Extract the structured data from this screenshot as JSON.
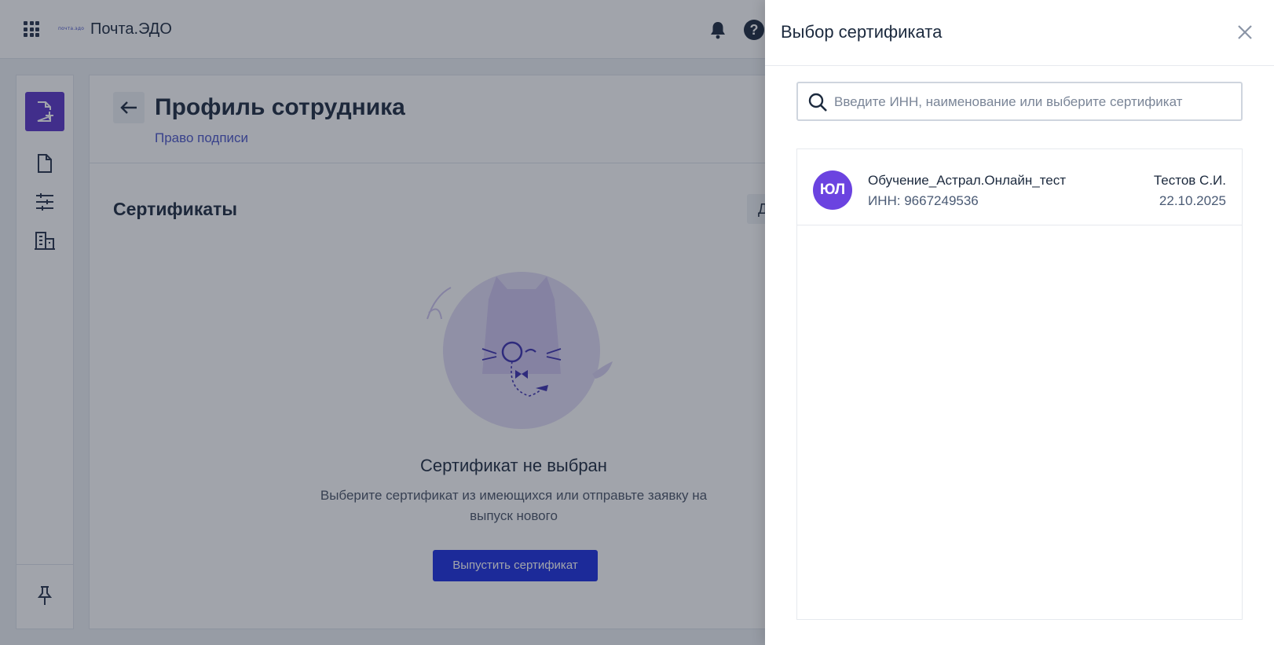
{
  "header": {
    "app_title": "Почта.ЭДО",
    "logo_text": "почта.эдо",
    "help_glyph": "?",
    "icons": [
      "apps-grid-icon",
      "bell-icon",
      "help-icon"
    ]
  },
  "sidebar": {
    "items": [
      {
        "name": "new-document-icon"
      },
      {
        "name": "document-icon"
      },
      {
        "name": "filters-icon"
      },
      {
        "name": "building-icon"
      },
      {
        "name": "pin-icon"
      }
    ],
    "accent_color": "#5a35c8"
  },
  "main": {
    "page_title": "Профиль сотрудника",
    "breadcrumb": "Право подписи",
    "section_title": "Сертификаты",
    "add_button_label": "Д",
    "empty_state": {
      "title": "Сертификат не выбран",
      "text": "Выберите сертификат из имеющихся или отправьте заявку на выпуск нового",
      "button_label": "Выпустить сертификат"
    },
    "button_color": "#1b2ee0"
  },
  "drawer": {
    "title": "Выбор сертификата",
    "search": {
      "placeholder": "Введите ИНН, наименование или выберите сертификат",
      "value": ""
    },
    "certificates": [
      {
        "avatar": "ЮЛ",
        "name": "Обучение_Астрал.Онлайн_тест",
        "inn": "ИНН: 9667249536",
        "owner": "Тестов С.И.",
        "date": "22.10.2025"
      }
    ],
    "avatar_color": "#6b43e0"
  }
}
